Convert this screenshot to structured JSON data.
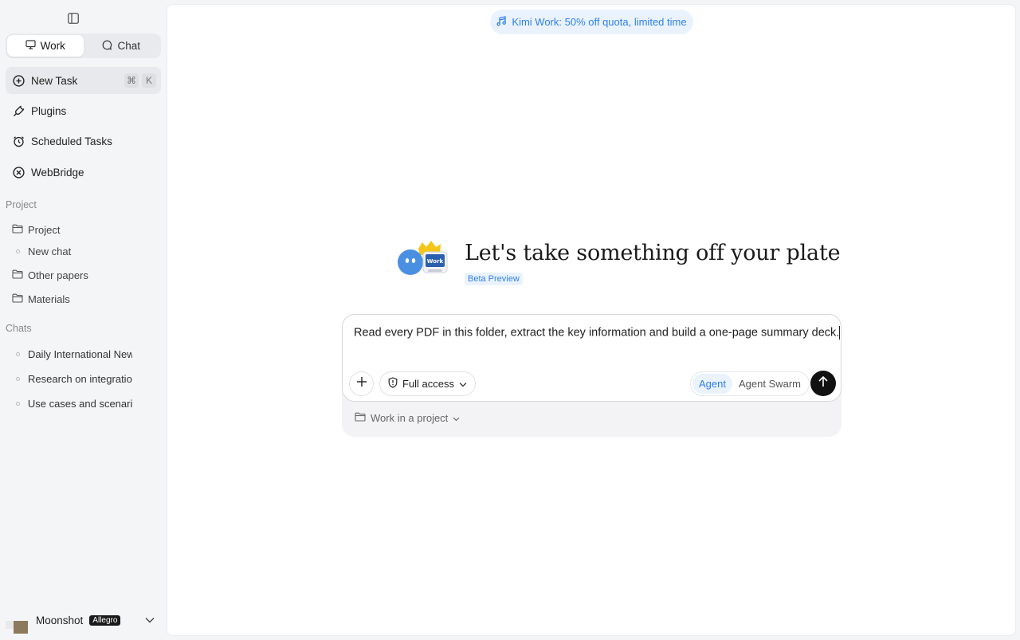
{
  "sidebar": {
    "mode_tabs": [
      {
        "label": "Work",
        "icon": "monitor-icon",
        "active": true
      },
      {
        "label": "Chat",
        "icon": "chat-bubble-icon",
        "active": false
      }
    ],
    "nav": [
      {
        "label": "New Task",
        "icon": "plus-circle-icon",
        "shortcut": [
          "⌘",
          "K"
        ]
      },
      {
        "label": "Plugins",
        "icon": "plug-icon"
      },
      {
        "label": "Scheduled Tasks",
        "icon": "alarm-clock-icon"
      },
      {
        "label": "WebBridge",
        "icon": "webbridge-icon"
      }
    ],
    "project_section_label": "Project",
    "projects": [
      {
        "label": "Project",
        "type": "folder"
      },
      {
        "label": "New chat",
        "type": "chat"
      },
      {
        "label": "Other papers",
        "type": "folder"
      },
      {
        "label": "Materials",
        "type": "folder"
      }
    ],
    "chats_section_label": "Chats",
    "chats": [
      {
        "label": "Daily International New"
      },
      {
        "label": "Research on integratio"
      },
      {
        "label": "Use cases and scenario"
      }
    ],
    "user": {
      "name": "Moonshot",
      "plan": "Allegro"
    }
  },
  "main": {
    "promo": "Kimi Work: 50% off quota, limited time",
    "title": "Let's take something off your plate",
    "badge": "Beta Preview",
    "composer": {
      "text": "Read every PDF in this folder, extract the key information and build a one-page summary deck.",
      "access_label": "Full access",
      "modes": [
        "Agent",
        "Agent Swarm"
      ],
      "active_mode": "Agent",
      "project_label": "Work in a project"
    }
  },
  "colors": {
    "accent": "#2f80ed",
    "send": "#111111"
  }
}
